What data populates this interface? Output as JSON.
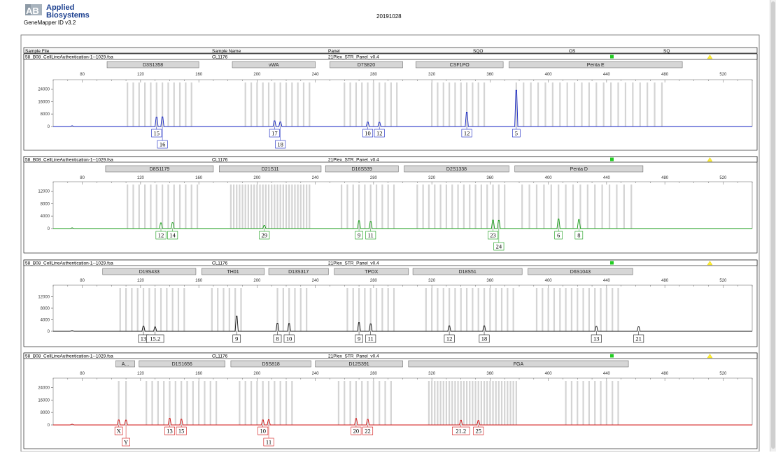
{
  "header": {
    "brand_line1": "Applied",
    "brand_line2": "Biosystems",
    "software": "GeneMapper ID v3.2",
    "date": "20191028"
  },
  "columns": [
    "Sample File",
    "Sample Name",
    "Panel",
    "SQO",
    "OS",
    "SQ"
  ],
  "colors": {
    "status_green": "#22cc22",
    "status_yellow": "#ffee33",
    "bin_gray": "#d4d4d4",
    "blue": "#1020c0",
    "green": "#109a10",
    "black": "#111111",
    "red": "#d01010"
  },
  "chart_data": [
    {
      "type": "line",
      "title": "",
      "sample_file": "58_B08_CellLineAuthentication-1--1029.fsa",
      "sample_name": "CL1176",
      "panel": "21Plex_STR_Panel_v0.4",
      "dye": "blue",
      "xlim": [
        60,
        540
      ],
      "x_ticks": [
        80,
        120,
        160,
        200,
        240,
        280,
        320,
        360,
        400,
        440,
        480,
        520
      ],
      "ylim": [
        0,
        30000
      ],
      "y_ticks": [
        0,
        8000,
        16000,
        24000
      ],
      "markers": [
        {
          "name": "D3S1358",
          "start": 97,
          "end": 160
        },
        {
          "name": "vWA",
          "start": 183,
          "end": 240
        },
        {
          "name": "D7S820",
          "start": 250,
          "end": 300
        },
        {
          "name": "CSF1PO",
          "start": 309,
          "end": 369
        },
        {
          "name": "Penta E",
          "start": 373,
          "end": 492
        }
      ],
      "bins": [
        111,
        115,
        119,
        123,
        127,
        131,
        135,
        139,
        143,
        147,
        151,
        155,
        192,
        196,
        200,
        204,
        208,
        212,
        216,
        220,
        224,
        228,
        232,
        236,
        260,
        264,
        268,
        272,
        276,
        280,
        284,
        288,
        292,
        296,
        320,
        324,
        328,
        332,
        336,
        340,
        344,
        348,
        352,
        356,
        378,
        383,
        388,
        393,
        398,
        403,
        408,
        413,
        418,
        423,
        428,
        433,
        438,
        443,
        448,
        453,
        458,
        463,
        468,
        473,
        478
      ],
      "peaks": [
        {
          "x": 131,
          "height": 6000,
          "label": "15"
        },
        {
          "x": 135,
          "height": 6200,
          "label": "16"
        },
        {
          "x": 212,
          "height": 3600,
          "label": "17"
        },
        {
          "x": 216,
          "height": 3000,
          "label": "18"
        },
        {
          "x": 276,
          "height": 2900,
          "label": "10"
        },
        {
          "x": 284,
          "height": 2700,
          "label": "12"
        },
        {
          "x": 344,
          "height": 9200,
          "label": "12"
        },
        {
          "x": 378,
          "height": 23200,
          "label": "5"
        }
      ]
    },
    {
      "type": "line",
      "title": "",
      "sample_file": "58_B08_CellLineAuthentication-1--1029.fsa",
      "sample_name": "CL1176",
      "panel": "21Plex_STR_Panel_v0.4",
      "dye": "green",
      "xlim": [
        60,
        540
      ],
      "x_ticks": [
        80,
        120,
        160,
        200,
        240,
        280,
        320,
        360,
        400,
        440,
        480,
        520
      ],
      "ylim": [
        0,
        15000
      ],
      "y_ticks": [
        0,
        4000,
        8000,
        12000
      ],
      "markers": [
        {
          "name": "D8S1179",
          "start": 96,
          "end": 170
        },
        {
          "name": "D21S11",
          "start": 174,
          "end": 244
        },
        {
          "name": "D16S539",
          "start": 247,
          "end": 297
        },
        {
          "name": "D2S1338",
          "start": 301,
          "end": 373
        },
        {
          "name": "Penta D",
          "start": 377,
          "end": 465
        }
      ],
      "bins": [
        111,
        115,
        119,
        123,
        127,
        131,
        135,
        139,
        143,
        147,
        151,
        155,
        159,
        182,
        184,
        186,
        188,
        190,
        192,
        194,
        196,
        198,
        200,
        202,
        204,
        206,
        208,
        210,
        212,
        214,
        216,
        218,
        220,
        222,
        224,
        226,
        228,
        230,
        232,
        234,
        236,
        258,
        262,
        266,
        270,
        274,
        278,
        282,
        286,
        290,
        294,
        310,
        314,
        318,
        322,
        326,
        330,
        334,
        338,
        342,
        346,
        350,
        354,
        358,
        362,
        366,
        370,
        382,
        387,
        392,
        397,
        402,
        407,
        412,
        417,
        422,
        427,
        432,
        437,
        442,
        447,
        452,
        457
      ],
      "peaks": [
        {
          "x": 134,
          "height": 1800,
          "label": "12"
        },
        {
          "x": 142,
          "height": 1900,
          "label": "14"
        },
        {
          "x": 205,
          "height": 1000,
          "label": "29"
        },
        {
          "x": 270,
          "height": 2500,
          "label": "9"
        },
        {
          "x": 278,
          "height": 2300,
          "label": "11"
        },
        {
          "x": 362,
          "height": 2700,
          "label": "23"
        },
        {
          "x": 366,
          "height": 2600,
          "label": "24"
        },
        {
          "x": 407,
          "height": 3100,
          "label": "6"
        },
        {
          "x": 421,
          "height": 2900,
          "label": "8"
        }
      ]
    },
    {
      "type": "line",
      "title": "",
      "sample_file": "58_B08_CellLineAuthentication-1--1029.fsa",
      "sample_name": "CL1176",
      "panel": "21Plex_STR_Panel_v0.4",
      "dye": "black",
      "xlim": [
        60,
        540
      ],
      "x_ticks": [
        80,
        120,
        160,
        200,
        240,
        280,
        320,
        360,
        400,
        440,
        480,
        520
      ],
      "ylim": [
        0,
        16000
      ],
      "y_ticks": [
        0,
        4000,
        8000,
        12000
      ],
      "markers": [
        {
          "name": "D19S433",
          "start": 94,
          "end": 158
        },
        {
          "name": "TH01",
          "start": 162,
          "end": 205
        },
        {
          "name": "D13S317",
          "start": 208,
          "end": 249
        },
        {
          "name": "TPOX",
          "start": 253,
          "end": 304
        },
        {
          "name": "D18S51",
          "start": 307,
          "end": 382
        },
        {
          "name": "D6S1043",
          "start": 386,
          "end": 458
        }
      ],
      "bins": [
        106,
        110,
        114,
        118,
        122,
        126,
        130,
        134,
        138,
        142,
        146,
        150,
        169,
        173,
        177,
        181,
        185,
        189,
        214,
        218,
        222,
        226,
        230,
        234,
        262,
        266,
        270,
        274,
        278,
        282,
        286,
        290,
        294,
        316,
        320,
        324,
        328,
        332,
        336,
        340,
        344,
        348,
        352,
        356,
        360,
        364,
        368,
        372,
        376,
        392,
        396,
        400,
        404,
        408,
        412,
        416,
        420,
        424,
        428,
        432,
        436,
        440,
        444,
        448
      ],
      "peaks": [
        {
          "x": 122,
          "height": 1800,
          "label": "13"
        },
        {
          "x": 130,
          "height": 1500,
          "label": "15.2"
        },
        {
          "x": 186,
          "height": 5300,
          "label": "9"
        },
        {
          "x": 214,
          "height": 2800,
          "label": "8"
        },
        {
          "x": 222,
          "height": 2700,
          "label": "10"
        },
        {
          "x": 270,
          "height": 3000,
          "label": "9"
        },
        {
          "x": 278,
          "height": 2600,
          "label": "11"
        },
        {
          "x": 332,
          "height": 1900,
          "label": "12"
        },
        {
          "x": 356,
          "height": 1900,
          "label": "18"
        },
        {
          "x": 433,
          "height": 1700,
          "label": "13"
        },
        {
          "x": 462,
          "height": 1600,
          "label": "21"
        }
      ]
    },
    {
      "type": "line",
      "title": "",
      "sample_file": "58_B08_CellLineAuthentication-1--1029.fsa",
      "sample_name": "CL1176",
      "panel": "21Plex_STR_Panel_v0.4",
      "dye": "red",
      "xlim": [
        60,
        540
      ],
      "x_ticks": [
        80,
        120,
        160,
        200,
        240,
        280,
        320,
        360,
        400,
        440,
        480,
        520
      ],
      "ylim": [
        0,
        30000
      ],
      "y_ticks": [
        0,
        8000,
        16000,
        24000
      ],
      "markers": [
        {
          "name": "A...",
          "start": 103,
          "end": 116
        },
        {
          "name": "D1S1656",
          "start": 119,
          "end": 178
        },
        {
          "name": "D5S818",
          "start": 182,
          "end": 237
        },
        {
          "name": "D12S391",
          "start": 240,
          "end": 300
        },
        {
          "name": "FGA",
          "start": 304,
          "end": 455
        }
      ],
      "bins": [
        105,
        110,
        124,
        128,
        132,
        136,
        140,
        144,
        148,
        152,
        156,
        160,
        164,
        168,
        172,
        188,
        192,
        196,
        200,
        204,
        208,
        212,
        216,
        220,
        224,
        256,
        260,
        264,
        268,
        272,
        276,
        280,
        284,
        288,
        292,
        318,
        320,
        322,
        324,
        326,
        328,
        330,
        332,
        334,
        336,
        338,
        340,
        342,
        344,
        346,
        348,
        350,
        352,
        354,
        356,
        358,
        360,
        362,
        364,
        366,
        368,
        370,
        372,
        374,
        376,
        378,
        412,
        416,
        420,
        424,
        428,
        432,
        436,
        440,
        444,
        448
      ],
      "peaks": [
        {
          "x": 105,
          "height": 3200,
          "label": "X"
        },
        {
          "x": 110,
          "height": 3100,
          "label": "Y"
        },
        {
          "x": 140,
          "height": 4200,
          "label": "13"
        },
        {
          "x": 148,
          "height": 3700,
          "label": "15"
        },
        {
          "x": 204,
          "height": 3200,
          "label": "10"
        },
        {
          "x": 208,
          "height": 3400,
          "label": "11"
        },
        {
          "x": 268,
          "height": 4100,
          "label": "20"
        },
        {
          "x": 276,
          "height": 3600,
          "label": "22"
        },
        {
          "x": 340,
          "height": 3000,
          "label": "21.2"
        },
        {
          "x": 352,
          "height": 2800,
          "label": "25"
        }
      ]
    }
  ]
}
